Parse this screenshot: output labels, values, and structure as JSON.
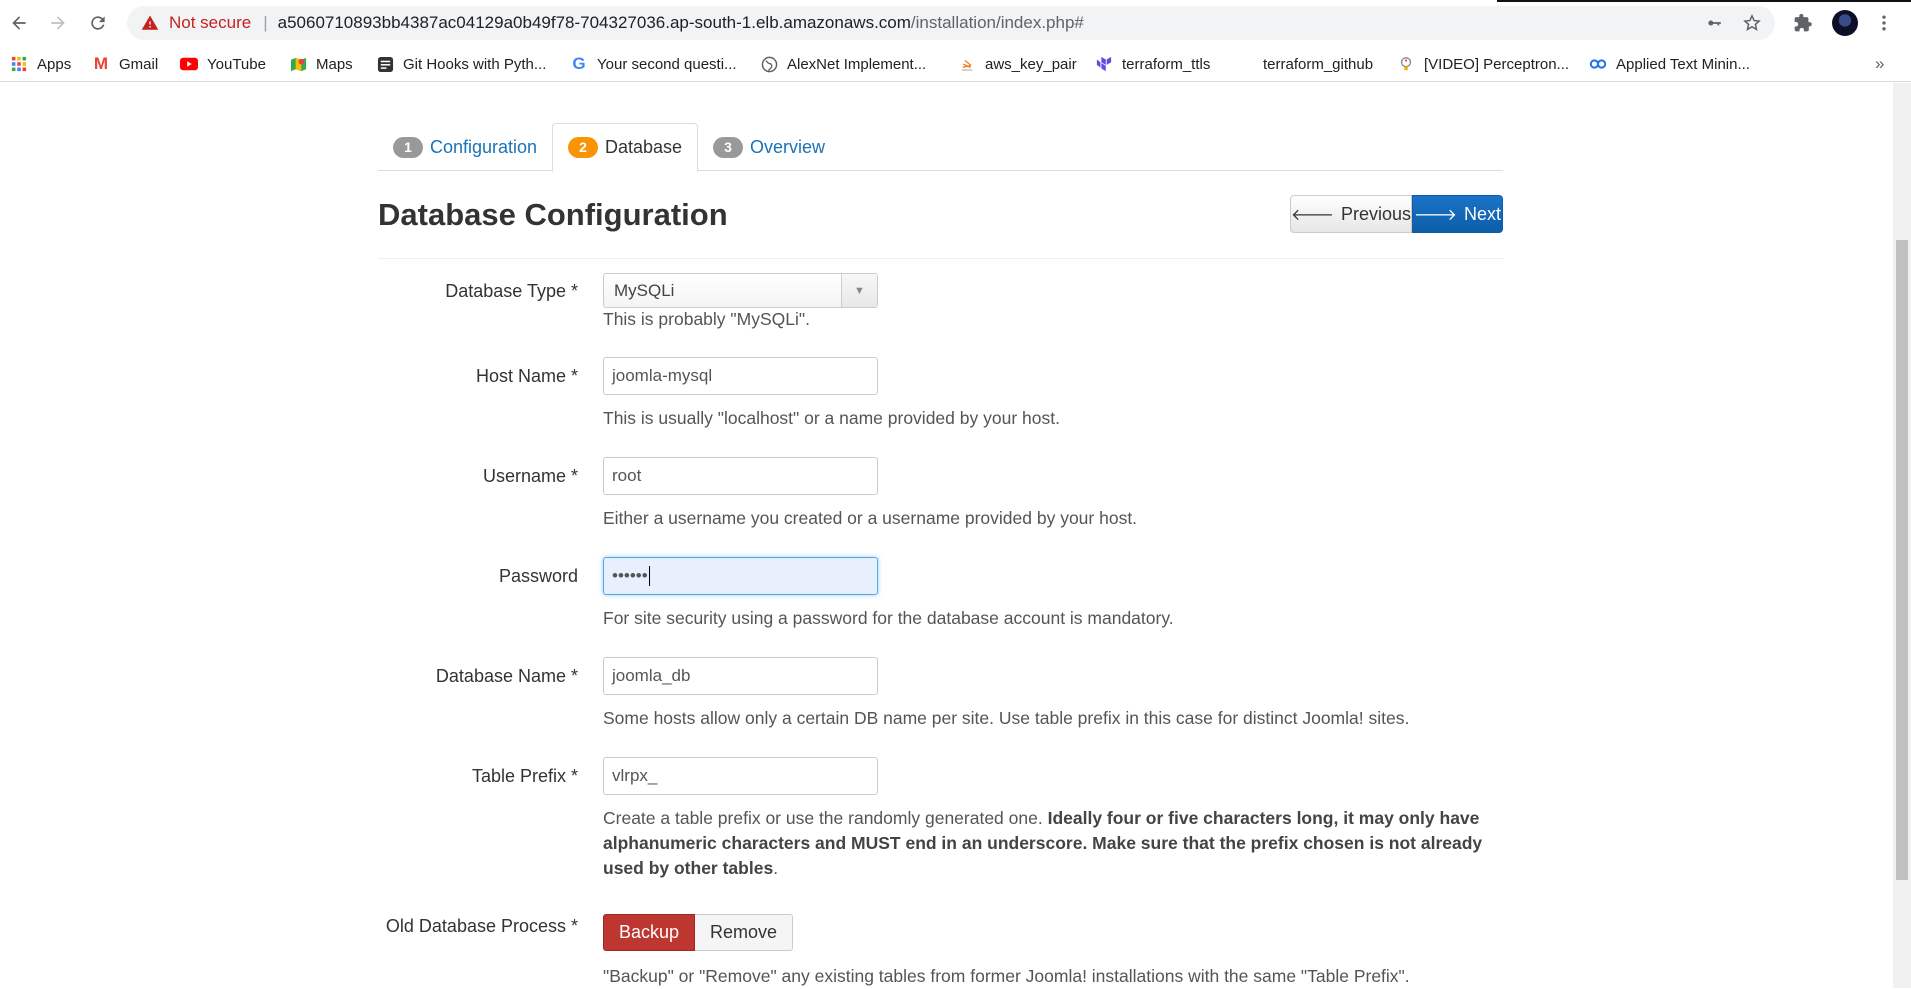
{
  "browser": {
    "not_secure": "Not secure",
    "url_host": "a5060710893bb4387ac04129a0b49f78-704327036.ap-south-1.elb.amazonaws.com",
    "url_path": "/installation/index.php#",
    "icons": [
      "back-arrow-icon",
      "forward-arrow-icon",
      "reload-icon",
      "warning-icon",
      "key-icon",
      "star-icon",
      "puzzle-icon",
      "avatar",
      "kebab-menu-icon"
    ]
  },
  "bookmarks": {
    "items": [
      {
        "label": "Apps",
        "icon": "apps-grid-icon"
      },
      {
        "label": "Gmail",
        "icon": "gmail-icon"
      },
      {
        "label": "YouTube",
        "icon": "youtube-icon"
      },
      {
        "label": "Maps",
        "icon": "maps-icon"
      },
      {
        "label": "Git Hooks with Pyth...",
        "icon": "doc-icon"
      },
      {
        "label": "Your second questi...",
        "icon": "google-icon"
      },
      {
        "label": "AlexNet Implement...",
        "icon": "globe-icon"
      },
      {
        "label": "aws_key_pair",
        "icon": "stack-icon"
      },
      {
        "label": "terraform_ttls",
        "icon": "terraform-icon"
      },
      {
        "label": "terraform_github",
        "icon": ""
      },
      {
        "label": "[VIDEO] Perceptron...",
        "icon": "bulb-icon"
      },
      {
        "label": "Applied Text Minin...",
        "icon": "link-icon"
      }
    ],
    "more": "»"
  },
  "tabs": [
    {
      "num": "1",
      "label": "Configuration"
    },
    {
      "num": "2",
      "label": "Database"
    },
    {
      "num": "3",
      "label": "Overview"
    }
  ],
  "page": {
    "title": "Database Configuration",
    "prev_label": "Previous",
    "next_label": "Next"
  },
  "form": {
    "db_type": {
      "label": "Database Type *",
      "value": "MySQLi",
      "help": "This is probably \"MySQLi\"."
    },
    "host": {
      "label": "Host Name *",
      "value": "joomla-mysql",
      "help": "This is usually \"localhost\" or a name provided by your host."
    },
    "username": {
      "label": "Username *",
      "value": "root",
      "help": "Either a username you created or a username provided by your host."
    },
    "password": {
      "label": "Password",
      "value": "••••••",
      "help": "For site security using a password for the database account is mandatory."
    },
    "db_name": {
      "label": "Database Name *",
      "value": "joomla_db",
      "help": "Some hosts allow only a certain DB name per site. Use table prefix in this case for distinct Joomla! sites."
    },
    "prefix": {
      "label": "Table Prefix *",
      "value": "vlrpx_",
      "help_plain": "Create a table prefix or use the randomly generated one. ",
      "help_bold": "Ideally four or five characters long, it may only have alphanumeric characters and MUST end in an underscore. Make sure that the prefix chosen is not already used by other tables",
      "help_end": "."
    },
    "old_db": {
      "label": "Old Database Process *",
      "backup": "Backup",
      "remove": "Remove",
      "help": "\"Backup\" or \"Remove\" any existing tables from former Joomla! installations with the same \"Table Prefix\"."
    }
  },
  "colors": {
    "link": "#1a73b8",
    "active_badge": "#f89406",
    "primary": "#0d5ea8",
    "danger": "#bd362f",
    "warning": "#c5221f"
  }
}
